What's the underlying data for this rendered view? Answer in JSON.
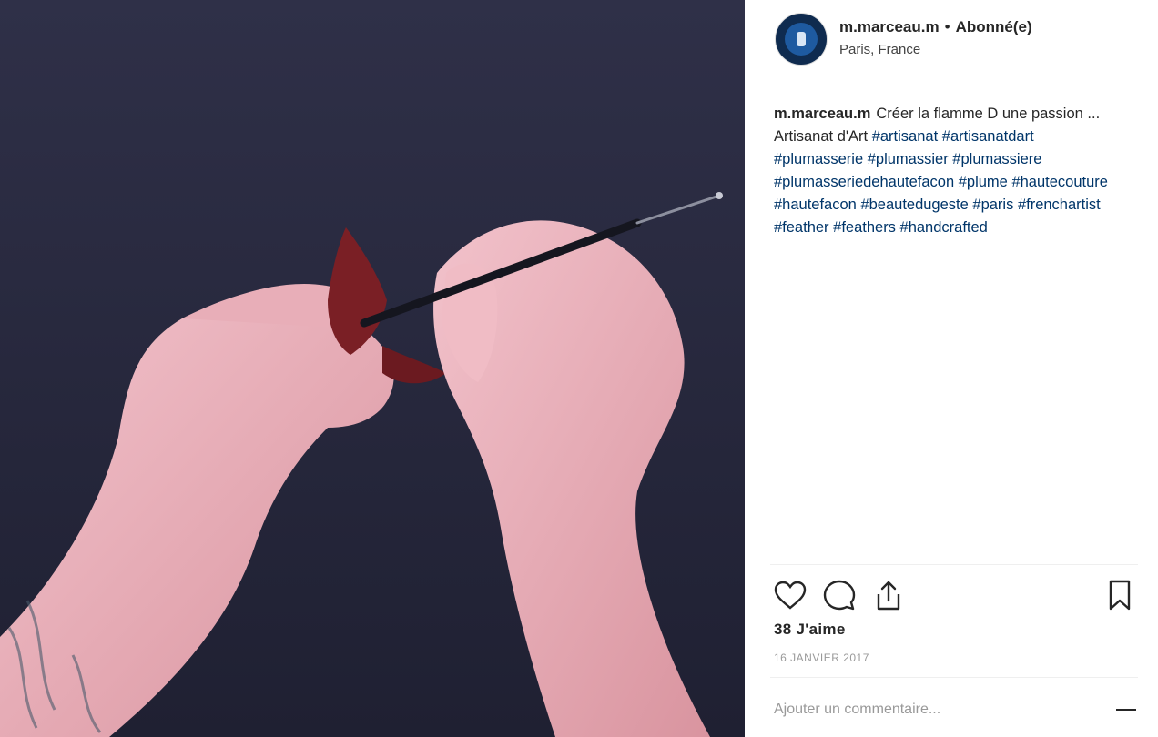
{
  "post": {
    "username": "m.marceau.m",
    "separator": "•",
    "follow_label": "Abonné(e)",
    "location": "Paris, France",
    "caption_text": "Créer la flamme D une passion ... Artisanat d'Art",
    "hashtags": [
      "#artisanat",
      "#artisanatdart",
      "#plumasserie",
      "#plumassier",
      "#plumassiere",
      "#plumasseriedehautefacon",
      "#plume",
      "#hautecouture",
      "#hautefacon",
      "#beautedugeste",
      "#paris",
      "#frenchartist",
      "#feather",
      "#feathers",
      "#handcrafted"
    ],
    "likes_label": "38 J'aime",
    "date_label": "16 JANVIER 2017",
    "comment_placeholder": "Ajouter un commentaire..."
  },
  "icons": [
    "heart-icon",
    "comment-icon",
    "share-icon",
    "bookmark-icon",
    "more-options-icon"
  ],
  "colors": {
    "photo_background": "#2a2b3f",
    "hashtag": "#003569",
    "text": "#262626",
    "muted": "#999999",
    "avatar": "#0f2b4f"
  }
}
